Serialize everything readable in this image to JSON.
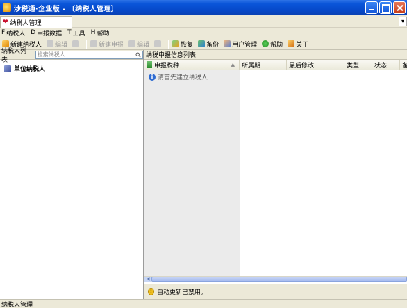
{
  "window": {
    "title": "涉税通·企业版 - 〔纳税人管理〕",
    "buttons": [
      "minimize-icon",
      "maximize-icon",
      "close-icon"
    ],
    "colors": {
      "titlebar": "#0a55d9",
      "close": "#c53a17"
    }
  },
  "tabs": [
    {
      "label": "纳税人管理",
      "icon": "heart-icon"
    }
  ],
  "menu": [
    {
      "key": "F",
      "label": "纳税人"
    },
    {
      "key": "D",
      "label": "申报数据"
    },
    {
      "key": "T",
      "label": "工具"
    },
    {
      "key": "H",
      "label": "帮助"
    }
  ],
  "toolbar": {
    "new_taxpayer": "新建纳税人",
    "edit": "编辑",
    "new_declaration": "新建申报",
    "edit2": "编辑",
    "restore": "恢复",
    "backup": "备份",
    "user_mgmt": "用户管理",
    "help": "帮助",
    "about": "关于"
  },
  "left_panel": {
    "title": "纳税人列表",
    "search_placeholder": "搜索纳税人...",
    "tree_root": "单位纳税人"
  },
  "right_panel": {
    "title": "纳税申报信息列表",
    "columns": [
      "申报税种",
      "所属期",
      "最后修改",
      "类型",
      "状态",
      "备"
    ],
    "hint": "请首先建立纳税人",
    "status_message": "自动更新已禁用。"
  },
  "statusbar": {
    "text": "纳税人管理"
  }
}
